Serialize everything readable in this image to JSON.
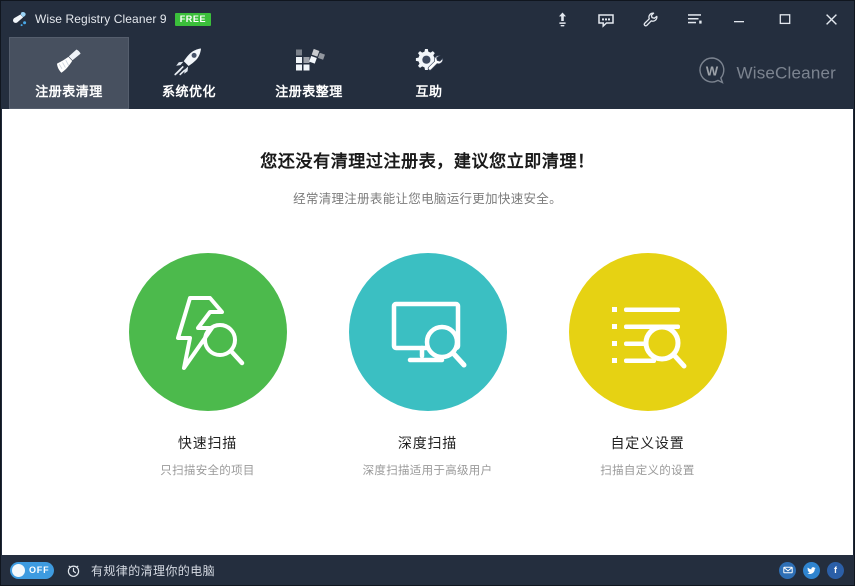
{
  "window": {
    "title": "Wise Registry Cleaner 9",
    "badge": "FREE",
    "app_icon": "broom-icon",
    "bg_color": "#242e3e",
    "content_bg": "#ffffff"
  },
  "titlebar": {
    "buttons": [
      {
        "name": "upgrade-icon",
        "tooltip": "Upgrade"
      },
      {
        "name": "feedback-icon",
        "tooltip": "Feedback"
      },
      {
        "name": "wrench-icon",
        "tooltip": "Settings"
      },
      {
        "name": "menu-icon",
        "tooltip": "Menu"
      }
    ],
    "minimize": "minimize-icon",
    "maximize": "maximize-icon",
    "close": "close-icon"
  },
  "nav": {
    "tabs": [
      {
        "label": "注册表清理",
        "icon": "broom-icon",
        "active": true
      },
      {
        "label": "系统优化",
        "icon": "rocket-icon",
        "active": false
      },
      {
        "label": "注册表整理",
        "icon": "blocks-icon",
        "active": false
      },
      {
        "label": "互助",
        "icon": "gear-wrench-icon",
        "active": false
      }
    ],
    "brand": "WiseCleaner",
    "brand_mark": "w-bubble-icon"
  },
  "main": {
    "headline": "您还没有清理过注册表，建议您立即清理！",
    "subline": "经常清理注册表能让您电脑运行更加快速安全。",
    "actions": [
      {
        "title": "快速扫描",
        "desc": "只扫描安全的项目",
        "color": "#4cba4c",
        "icon": "lightning-search-icon"
      },
      {
        "title": "深度扫描",
        "desc": "深度扫描适用于高级用户",
        "color": "#3bbfc2",
        "icon": "monitor-search-icon"
      },
      {
        "title": "自定义设置",
        "desc": "扫描自定义的设置",
        "color": "#e6d213",
        "icon": "list-search-icon"
      }
    ]
  },
  "statusbar": {
    "toggle_state": "OFF",
    "toggle_color": "#3e9be0",
    "clock_icon": "alarm-clock-icon",
    "text": "有规律的清理你的电脑",
    "social": [
      {
        "name": "email-icon",
        "glyph": "✉"
      },
      {
        "name": "twitter-icon",
        "glyph": "🐦"
      },
      {
        "name": "facebook-icon",
        "glyph": "f"
      }
    ]
  }
}
